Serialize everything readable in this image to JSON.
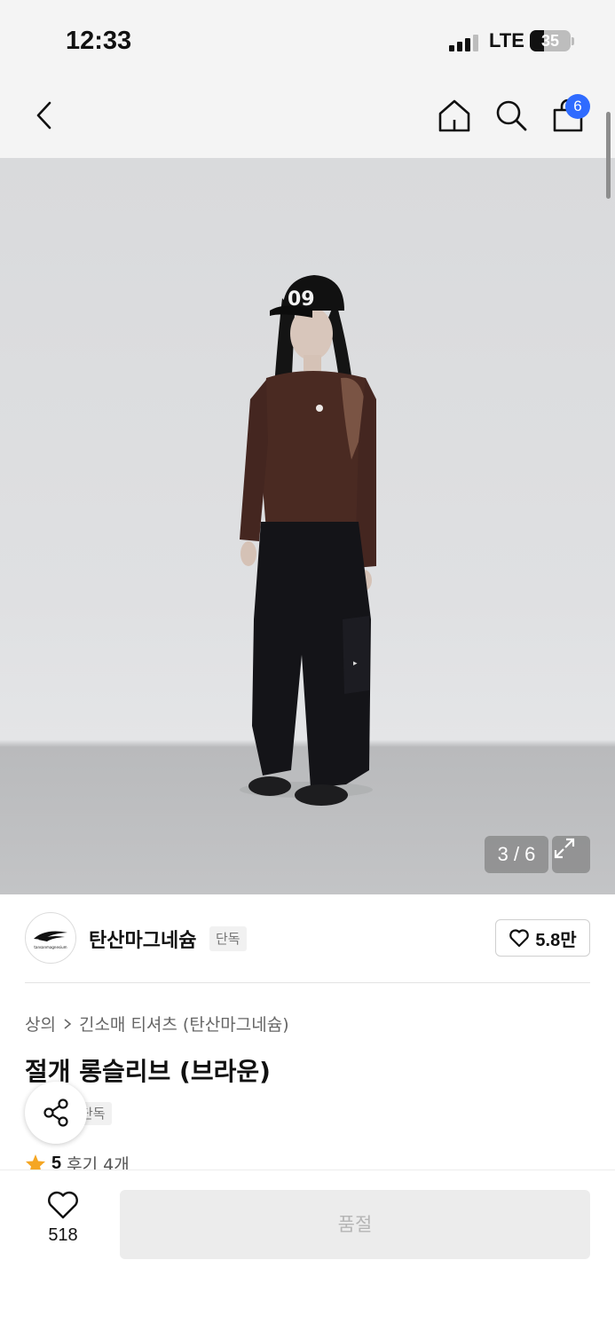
{
  "status_bar": {
    "time": "12:33",
    "network": "LTE",
    "battery": "35",
    "battery_level": 0.35,
    "signal_bars": 3
  },
  "nav": {
    "back_icon": "chevron-left-icon",
    "home_icon": "home-icon",
    "search_icon": "search-icon",
    "cart_icon": "shopping-bag-icon",
    "cart_count": "6",
    "badge_color": "#2f6bff"
  },
  "gallery": {
    "counter": "3 / 6",
    "expand_icon": "expand-icon"
  },
  "brand": {
    "name": "탄산마그네슘",
    "tag": "단독",
    "like_icon": "heart-icon",
    "like_count": "5.8만",
    "logo_text": "tansanmagnesium"
  },
  "product": {
    "breadcrumb": [
      "상의",
      "긴소매 티셔츠 (탄산마그네슘)"
    ],
    "title": "절개 롱슬리브 (브라운)",
    "exclusive_tag": "단독",
    "rating": "5",
    "review_label": "후기 4개",
    "star_color": "#f5a623"
  },
  "bottom_bar": {
    "wish_count": "518",
    "purchase_label": "품절"
  }
}
